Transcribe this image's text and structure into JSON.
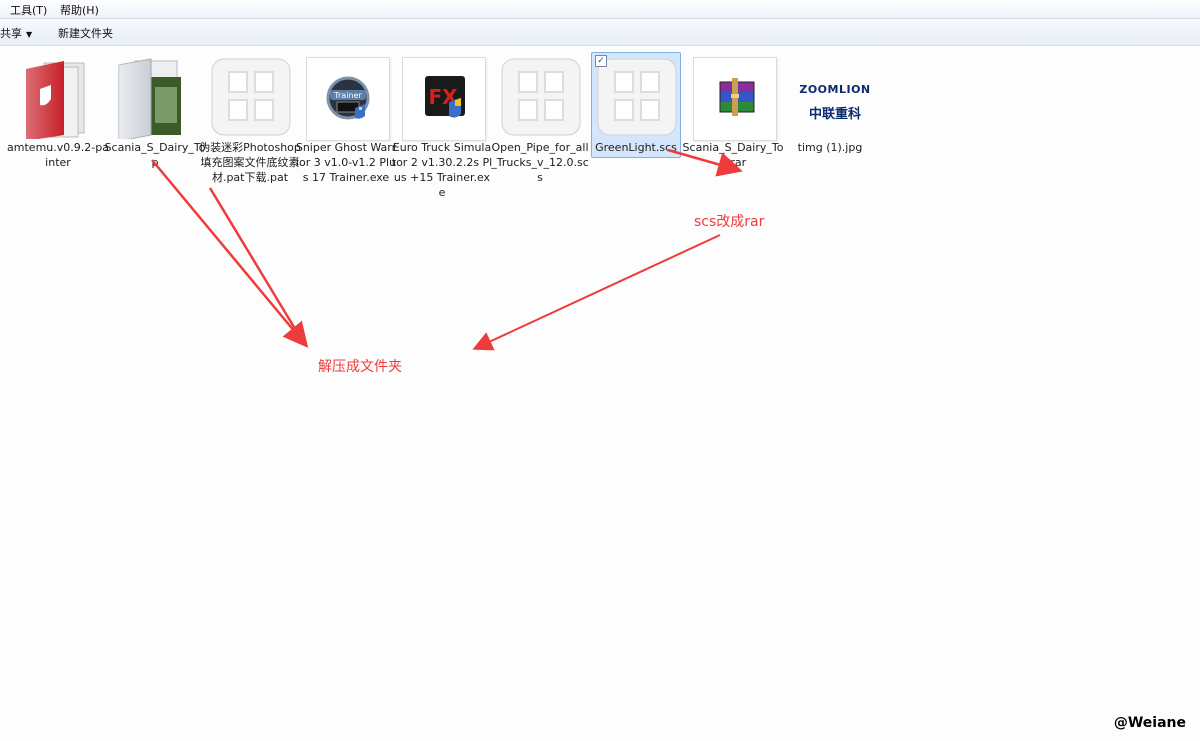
{
  "menubar": {
    "tools": "工具(T)",
    "help": "帮助(H)"
  },
  "toolbar": {
    "share": "共享",
    "new_folder": "新建文件夹"
  },
  "files": [
    {
      "label": "amtemu.v0.9.2-painter",
      "icon": "shield-folder-icon"
    },
    {
      "label": "Scania_S_Dairy_Top",
      "icon": "folder-icon"
    },
    {
      "label": "伪装迷彩Photoshop填充图案文件底纹素材.pat下载.pat",
      "icon": "generic-file-icon"
    },
    {
      "label": "Sniper Ghost Warrior 3 v1.0-v1.2 Plus 17 Trainer.exe",
      "icon": "trainer-exe-icon"
    },
    {
      "label": "Euro Truck Simulator 2 v1.30.2.2s Plus +15 Trainer.exe",
      "icon": "fx-exe-icon"
    },
    {
      "label": "Open_Pipe_for_all_Trucks_v_12.0.scs",
      "icon": "generic-file-icon"
    },
    {
      "label": "GreenLight.scs",
      "icon": "generic-file-icon",
      "selected": true
    },
    {
      "label": "Scania_S_Dairy_Top.rar",
      "icon": "winrar-archive-icon"
    },
    {
      "label": "timg (1).jpg",
      "icon": "zoomlion-image-icon"
    }
  ],
  "zoomlion": {
    "en": "ZOOMLION",
    "cn": "中联重科"
  },
  "annotations": {
    "rename": "scs改成rar",
    "extract": "解压成文件夹"
  },
  "watermark": "@Weiane",
  "colors": {
    "annotation": "#ee3b3b",
    "selection": "#d4e6fb"
  }
}
